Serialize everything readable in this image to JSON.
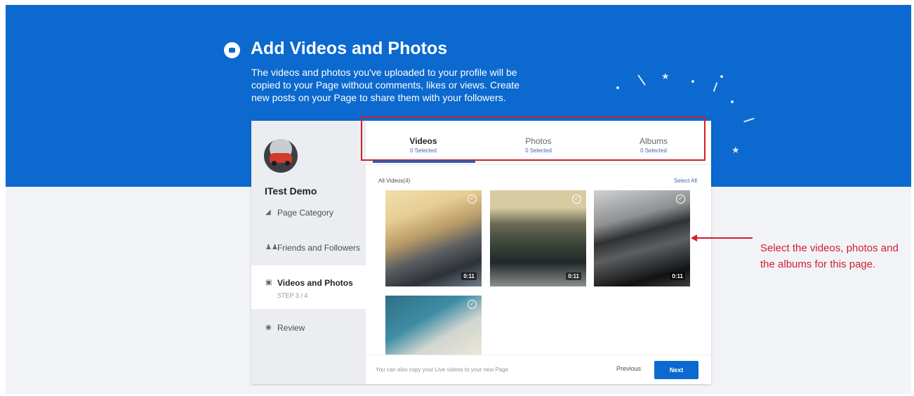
{
  "header": {
    "title": "Add Videos and Photos",
    "description": "The videos and photos you've uploaded to your profile will be copied to your Page without comments, likes or views. Create new posts on your Page to share them with your followers."
  },
  "sidebar": {
    "page_name": "ITest Demo",
    "items": [
      {
        "label": "Page Category",
        "icon": "tag-icon",
        "sub": ""
      },
      {
        "label": "Friends and Followers",
        "icon": "people-icon",
        "sub": ""
      },
      {
        "label": "Videos and Photos",
        "icon": "video-icon",
        "sub": "STEP 3 / 4"
      },
      {
        "label": "Review",
        "icon": "eye-icon",
        "sub": ""
      }
    ]
  },
  "tabs": [
    {
      "label": "Videos",
      "sub": "0 Selected"
    },
    {
      "label": "Photos",
      "sub": "0 Selected"
    },
    {
      "label": "Albums",
      "sub": "0 Selected"
    }
  ],
  "videos": {
    "all_label": "All Videos(4)",
    "select_all": "Select All",
    "items": [
      {
        "duration": "0:11"
      },
      {
        "duration": "0:11"
      },
      {
        "duration": "0:11"
      },
      {
        "duration": ""
      }
    ]
  },
  "footer": {
    "note": "You can also copy your Live videos to your new Page",
    "previous": "Previous",
    "next": "Next"
  },
  "annotation": "Select the videos, photos and the albums for this page.",
  "colors": {
    "brand_blue": "#0b69cf",
    "annotation_red": "#d21f2c"
  }
}
